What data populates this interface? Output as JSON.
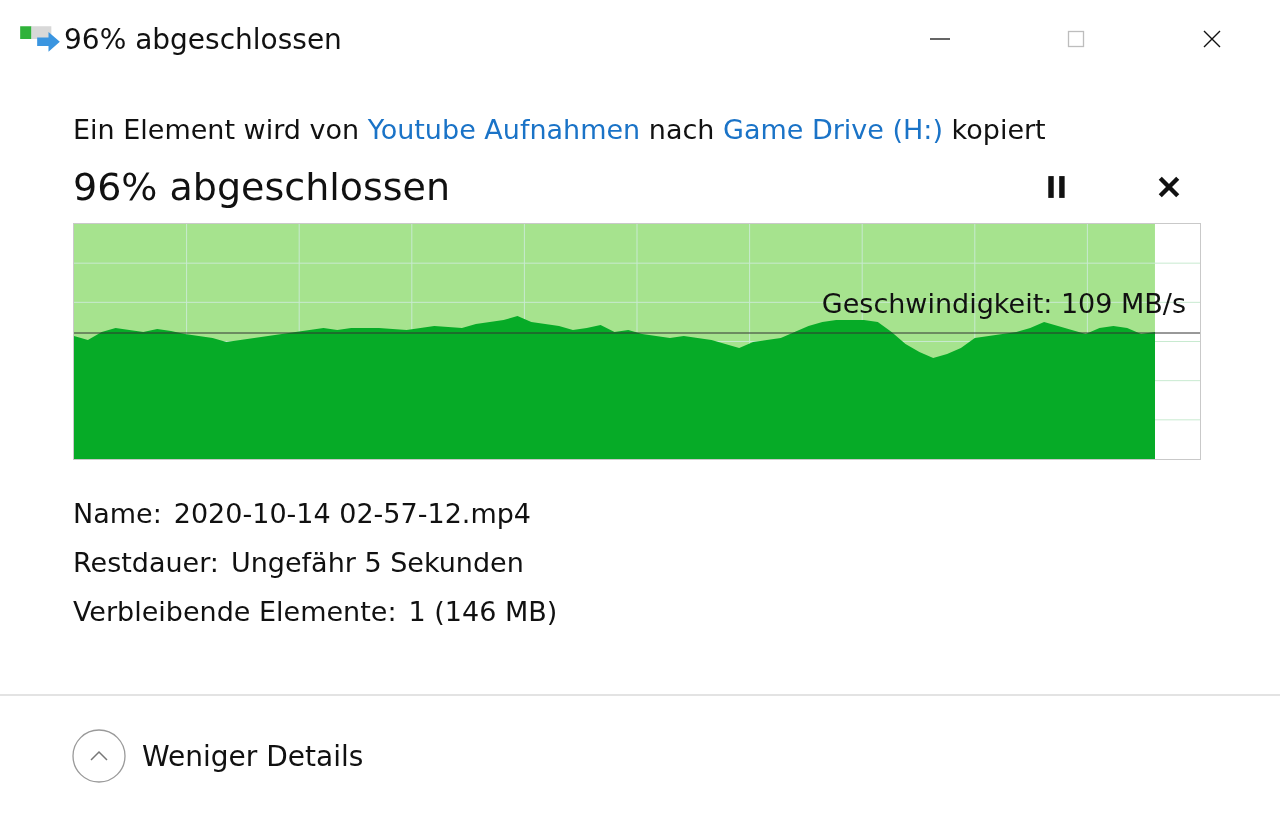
{
  "window": {
    "title": "96% abgeschlossen",
    "maximize_disabled": true
  },
  "description": {
    "parts": [
      {
        "kind": "text",
        "text": "Ein Element wird von "
      },
      {
        "kind": "link",
        "text": "Youtube Aufnahmen"
      },
      {
        "kind": "text",
        "text": " nach "
      },
      {
        "kind": "link",
        "text": "Game Drive (H:)"
      },
      {
        "kind": "text",
        "text": " kopiert"
      }
    ]
  },
  "progress": {
    "heading": "96% abgeschlossen",
    "level": 0.96,
    "speed": "Geschwindigkeit: 109 MB/s"
  },
  "details": [
    {
      "label": "Name:",
      "value": "2020-10-14 02-57-12.mp4"
    },
    {
      "label": "Restdauer:",
      "value": "Ungefähr 5 Sekunden"
    },
    {
      "label": "Verbleibende Elemente:",
      "value": "1 (146 MB)"
    }
  ],
  "toggle": {
    "label": "Weniger Details",
    "expanded": true
  }
}
